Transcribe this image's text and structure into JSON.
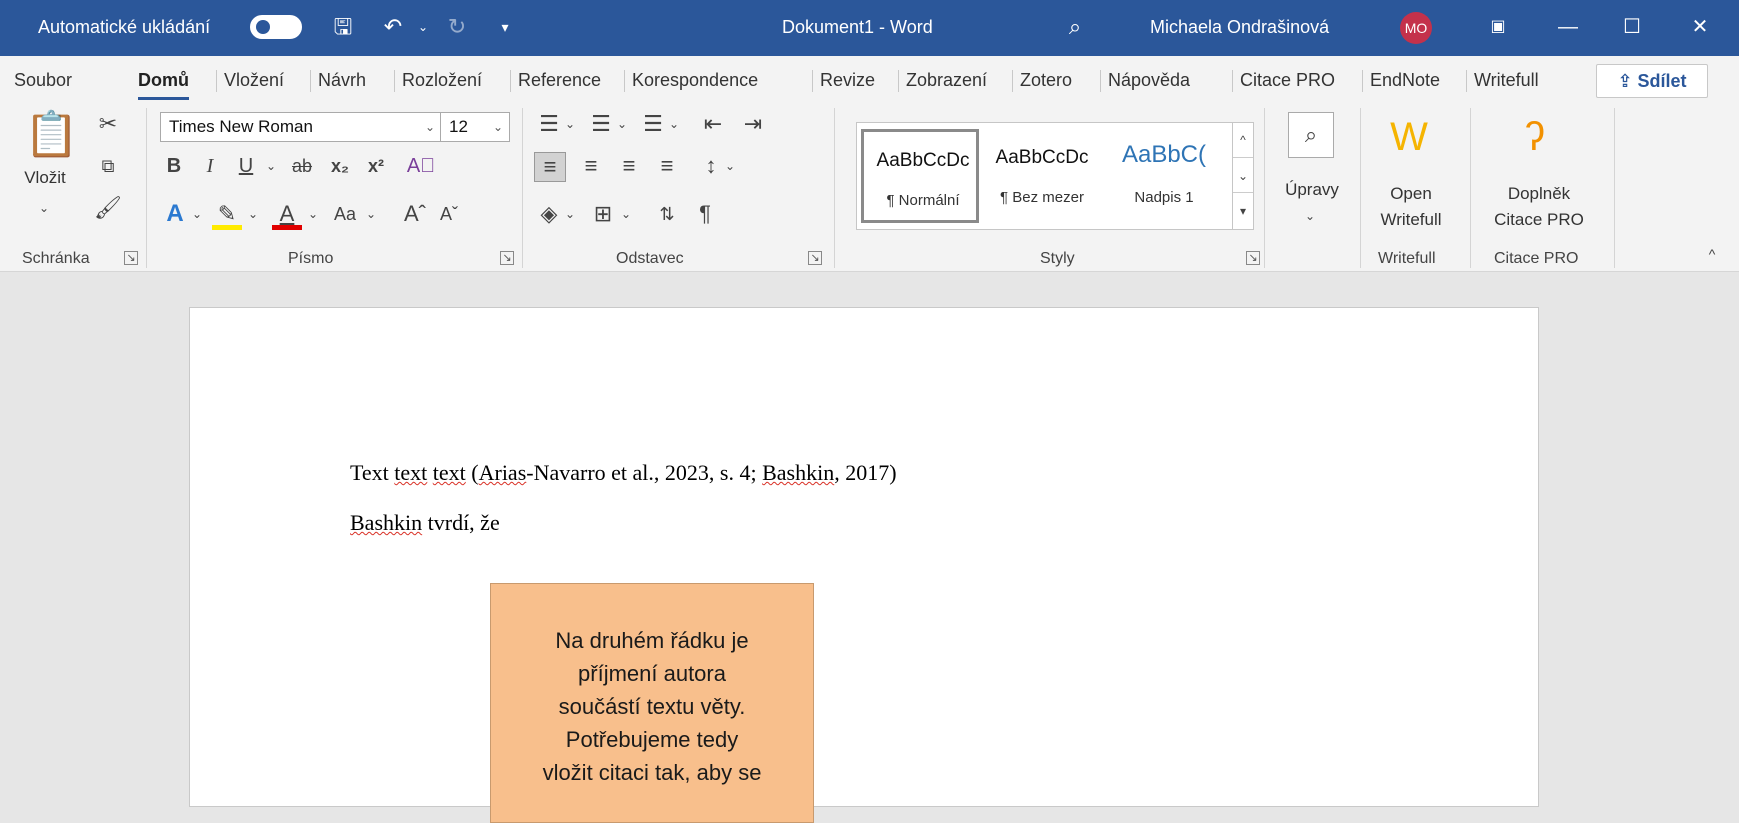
{
  "titlebar": {
    "autosave_label": "Automatické ukládání",
    "doc_title": "Dokument1  -  Word",
    "user_name": "Michaela Ondrašinová",
    "avatar_initials": "MO"
  },
  "tabs": [
    "Soubor",
    "Domů",
    "Vložení",
    "Návrh",
    "Rozložení",
    "Reference",
    "Korespondence",
    "Revize",
    "Zobrazení",
    "Zotero",
    "Nápověda",
    "Citace PRO",
    "EndNote",
    "Writefull"
  ],
  "active_tab": "Domů",
  "share_label": "Sdílet",
  "clipboard": {
    "paste_label": "Vložit",
    "group_label": "Schránka"
  },
  "font": {
    "name": "Times New Roman",
    "size": "12",
    "group_label": "Písmo",
    "case_label": "Aa"
  },
  "paragraph": {
    "group_label": "Odstavec"
  },
  "styles": {
    "group_label": "Styly",
    "items": [
      {
        "preview": "AaBbCcDc",
        "label": "¶ Normální"
      },
      {
        "preview": "AaBbCcDc",
        "label": "¶ Bez mezer"
      },
      {
        "preview": "AaBbC(",
        "label": "Nadpis 1"
      }
    ]
  },
  "editing": {
    "label": "Úpravy"
  },
  "writefull": {
    "button_line1": "Open",
    "button_line2": "Writefull",
    "group_label": "Writefull"
  },
  "citace": {
    "button_line1": "Doplněk",
    "button_line2": "Citace PRO",
    "group_label": "Citace PRO"
  },
  "document": {
    "line1": {
      "t1": "Text ",
      "t2": "text",
      "t3": " ",
      "t4": "text",
      "t5": " (",
      "t6": "Arias",
      "t7": "-Navarro et al., 2023, s. 4; ",
      "t8": "Bashkin",
      "t9": ", 2017)"
    },
    "line2": {
      "t1": "Bashkin",
      "t2": " tvrdí, že"
    }
  },
  "callout": {
    "l1": "Na druhém řádku je",
    "l2": "příjmení autora",
    "l3": "součástí textu věty.",
    "l4": "Potřebujeme tedy",
    "l5": "vložit citaci tak, aby se"
  },
  "colors": {
    "titlebar": "#2b579a",
    "callout": "#f8bf8c",
    "avatar": "#c4314b"
  }
}
